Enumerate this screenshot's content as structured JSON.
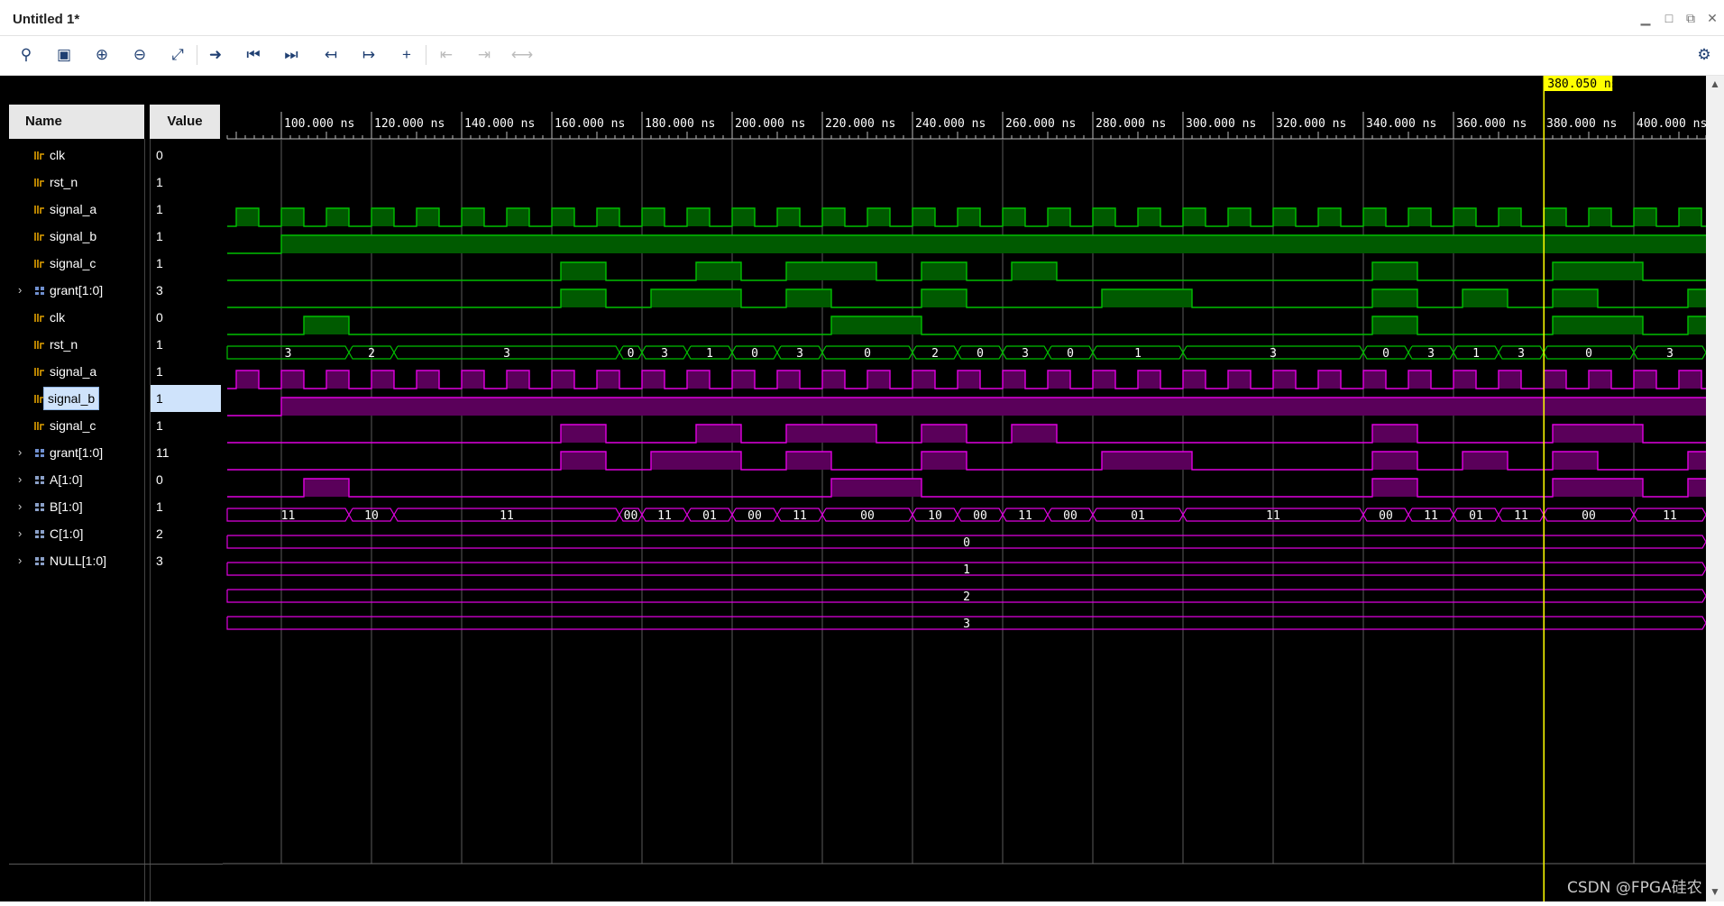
{
  "window": {
    "title": "Untitled 1*"
  },
  "window_controls": [
    "minimize",
    "maximize",
    "restore",
    "close"
  ],
  "toolbar": {
    "buttons": [
      {
        "name": "search",
        "glyph": "⚲",
        "enabled": true
      },
      {
        "name": "save",
        "glyph": "▣",
        "enabled": true
      },
      {
        "name": "zoom-in",
        "glyph": "⊕",
        "enabled": true
      },
      {
        "name": "zoom-out",
        "glyph": "⊖",
        "enabled": true
      },
      {
        "name": "zoom-fit",
        "glyph": "⤢",
        "enabled": true
      },
      {
        "name": "go-to-cursor",
        "glyph": "➜",
        "enabled": true
      },
      {
        "name": "go-to-time-zero",
        "glyph": "⏮",
        "enabled": true
      },
      {
        "name": "go-to-last-time",
        "glyph": "⏭",
        "enabled": true
      },
      {
        "name": "previous-transition",
        "glyph": "↤",
        "enabled": true
      },
      {
        "name": "next-transition",
        "glyph": "↦",
        "enabled": true
      },
      {
        "name": "add-marker",
        "glyph": "+",
        "enabled": true
      },
      {
        "name": "previous-marker",
        "glyph": "⇤",
        "enabled": false
      },
      {
        "name": "next-marker",
        "glyph": "⇥",
        "enabled": false
      },
      {
        "name": "swap-cursors",
        "glyph": "⟷",
        "enabled": false
      }
    ],
    "settings_glyph": "⚙"
  },
  "columns": {
    "name_header": "Name",
    "value_header": "Value"
  },
  "cursor": {
    "label": "380.050",
    "unit": "ns",
    "time": 380.05,
    "color": "#ffff00"
  },
  "timeline": {
    "start": 88,
    "end": 416,
    "ticks": [
      {
        "label": "100.000",
        "unit": "ns",
        "t": 100
      },
      {
        "label": "120.000",
        "unit": "ns",
        "t": 120
      },
      {
        "label": "140.000",
        "unit": "ns",
        "t": 140
      },
      {
        "label": "160.000",
        "unit": "ns",
        "t": 160
      },
      {
        "label": "180.000",
        "unit": "ns",
        "t": 180
      },
      {
        "label": "200.000",
        "unit": "ns",
        "t": 200
      },
      {
        "label": "220.000",
        "unit": "ns",
        "t": 220
      },
      {
        "label": "240.000",
        "unit": "ns",
        "t": 240
      },
      {
        "label": "260.000",
        "unit": "ns",
        "t": 260
      },
      {
        "label": "280.000",
        "unit": "ns",
        "t": 280
      },
      {
        "label": "300.000",
        "unit": "ns",
        "t": 300
      },
      {
        "label": "320.000",
        "unit": "ns",
        "t": 320
      },
      {
        "label": "340.000",
        "unit": "ns",
        "t": 340
      },
      {
        "label": "360.000",
        "unit": "ns",
        "t": 360
      },
      {
        "label": "380.000",
        "unit": "ns",
        "t": 380
      },
      {
        "label": "400.000",
        "unit": "ns",
        "t": 400
      }
    ]
  },
  "colors": {
    "green": "#00c000",
    "green_fill": "#005a00",
    "magenta": "#e000e0",
    "magenta_fill": "#5a005a",
    "grid": "#5a5a5a",
    "cursor": "#ffff00",
    "bus_text": "#ffffff"
  },
  "signals": [
    {
      "name": "clk",
      "value": "0",
      "icon": "bit",
      "expandable": false,
      "color": "green",
      "kind": "clock",
      "period": 10,
      "phase": -3
    },
    {
      "name": "rst_n",
      "value": "1",
      "icon": "bit",
      "expandable": false,
      "color": "green",
      "kind": "bit",
      "edges": [
        [
          88,
          0
        ],
        [
          100,
          1
        ]
      ]
    },
    {
      "name": "signal_a",
      "value": "1",
      "icon": "bit",
      "expandable": false,
      "color": "green",
      "kind": "bit",
      "edges": [
        [
          88,
          0
        ],
        [
          162,
          1
        ],
        [
          172,
          0
        ],
        [
          192,
          1
        ],
        [
          202,
          0
        ],
        [
          212,
          1
        ],
        [
          232,
          0
        ],
        [
          242,
          1
        ],
        [
          252,
          0
        ],
        [
          262,
          1
        ],
        [
          272,
          0
        ],
        [
          342,
          1
        ],
        [
          352,
          0
        ],
        [
          382,
          1
        ],
        [
          402,
          0
        ]
      ]
    },
    {
      "name": "signal_b",
      "value": "1",
      "icon": "bit",
      "expandable": false,
      "color": "green",
      "kind": "bit",
      "edges": [
        [
          88,
          0
        ],
        [
          162,
          1
        ],
        [
          172,
          0
        ],
        [
          182,
          1
        ],
        [
          202,
          0
        ],
        [
          212,
          1
        ],
        [
          222,
          0
        ],
        [
          242,
          1
        ],
        [
          252,
          0
        ],
        [
          282,
          1
        ],
        [
          302,
          0
        ],
        [
          342,
          1
        ],
        [
          352,
          0
        ],
        [
          362,
          1
        ],
        [
          372,
          0
        ],
        [
          382,
          1
        ],
        [
          392,
          0
        ],
        [
          412,
          1
        ]
      ]
    },
    {
      "name": "signal_c",
      "value": "1",
      "icon": "bit",
      "expandable": false,
      "color": "green",
      "kind": "bit",
      "edges": [
        [
          88,
          0
        ],
        [
          105,
          1
        ],
        [
          115,
          0
        ],
        [
          222,
          1
        ],
        [
          242,
          0
        ],
        [
          342,
          1
        ],
        [
          352,
          0
        ],
        [
          382,
          1
        ],
        [
          402,
          0
        ],
        [
          412,
          1
        ]
      ]
    },
    {
      "name": "grant[1:0]",
      "value": "3",
      "icon": "bus",
      "expandable": true,
      "color": "green",
      "kind": "bus",
      "segments": [
        [
          88,
          "3"
        ],
        [
          115,
          "2"
        ],
        [
          125,
          "3"
        ],
        [
          175,
          "0"
        ],
        [
          180,
          "3"
        ],
        [
          190,
          "1"
        ],
        [
          200,
          "0"
        ],
        [
          210,
          "3"
        ],
        [
          220,
          "0"
        ],
        [
          240,
          "2"
        ],
        [
          250,
          "0"
        ],
        [
          260,
          "3"
        ],
        [
          270,
          "0"
        ],
        [
          280,
          "1"
        ],
        [
          300,
          "3"
        ],
        [
          340,
          "0"
        ],
        [
          350,
          "3"
        ],
        [
          360,
          "1"
        ],
        [
          370,
          "3"
        ],
        [
          380,
          "0"
        ],
        [
          400,
          "3"
        ]
      ]
    },
    {
      "name": "clk",
      "value": "0",
      "icon": "bit",
      "expandable": false,
      "color": "magenta",
      "kind": "clock",
      "period": 10,
      "phase": -3
    },
    {
      "name": "rst_n",
      "value": "1",
      "icon": "bit",
      "expandable": false,
      "color": "magenta",
      "kind": "bit",
      "edges": [
        [
          88,
          0
        ],
        [
          100,
          1
        ]
      ]
    },
    {
      "name": "signal_a",
      "value": "1",
      "icon": "bit",
      "expandable": false,
      "color": "magenta",
      "kind": "bit",
      "edges": [
        [
          88,
          0
        ],
        [
          162,
          1
        ],
        [
          172,
          0
        ],
        [
          192,
          1
        ],
        [
          202,
          0
        ],
        [
          212,
          1
        ],
        [
          232,
          0
        ],
        [
          242,
          1
        ],
        [
          252,
          0
        ],
        [
          262,
          1
        ],
        [
          272,
          0
        ],
        [
          342,
          1
        ],
        [
          352,
          0
        ],
        [
          382,
          1
        ],
        [
          402,
          0
        ]
      ]
    },
    {
      "name": "signal_b",
      "value": "1",
      "icon": "bit",
      "expandable": false,
      "color": "magenta",
      "kind": "bit",
      "selected": true,
      "edges": [
        [
          88,
          0
        ],
        [
          162,
          1
        ],
        [
          172,
          0
        ],
        [
          182,
          1
        ],
        [
          202,
          0
        ],
        [
          212,
          1
        ],
        [
          222,
          0
        ],
        [
          242,
          1
        ],
        [
          252,
          0
        ],
        [
          282,
          1
        ],
        [
          302,
          0
        ],
        [
          342,
          1
        ],
        [
          352,
          0
        ],
        [
          362,
          1
        ],
        [
          372,
          0
        ],
        [
          382,
          1
        ],
        [
          392,
          0
        ],
        [
          412,
          1
        ]
      ]
    },
    {
      "name": "signal_c",
      "value": "1",
      "icon": "bit",
      "expandable": false,
      "color": "magenta",
      "kind": "bit",
      "edges": [
        [
          88,
          0
        ],
        [
          105,
          1
        ],
        [
          115,
          0
        ],
        [
          222,
          1
        ],
        [
          242,
          0
        ],
        [
          342,
          1
        ],
        [
          352,
          0
        ],
        [
          382,
          1
        ],
        [
          402,
          0
        ],
        [
          412,
          1
        ]
      ]
    },
    {
      "name": "grant[1:0]",
      "value": "11",
      "icon": "bus",
      "expandable": true,
      "color": "magenta",
      "kind": "bus",
      "segments": [
        [
          88,
          "11"
        ],
        [
          115,
          "10"
        ],
        [
          125,
          "11"
        ],
        [
          175,
          "00"
        ],
        [
          180,
          "11"
        ],
        [
          190,
          "01"
        ],
        [
          200,
          "00"
        ],
        [
          210,
          "11"
        ],
        [
          220,
          "00"
        ],
        [
          240,
          "10"
        ],
        [
          250,
          "00"
        ],
        [
          260,
          "11"
        ],
        [
          270,
          "00"
        ],
        [
          280,
          "01"
        ],
        [
          300,
          "11"
        ],
        [
          340,
          "00"
        ],
        [
          350,
          "11"
        ],
        [
          360,
          "01"
        ],
        [
          370,
          "11"
        ],
        [
          380,
          "00"
        ],
        [
          400,
          "11"
        ]
      ]
    },
    {
      "name": "A[1:0]",
      "value": "0",
      "icon": "param",
      "expandable": true,
      "color": "magenta",
      "kind": "bus",
      "segments": [
        [
          88,
          "0"
        ]
      ]
    },
    {
      "name": "B[1:0]",
      "value": "1",
      "icon": "param",
      "expandable": true,
      "color": "magenta",
      "kind": "bus",
      "segments": [
        [
          88,
          "1"
        ]
      ]
    },
    {
      "name": "C[1:0]",
      "value": "2",
      "icon": "param",
      "expandable": true,
      "color": "magenta",
      "kind": "bus",
      "segments": [
        [
          88,
          "2"
        ]
      ]
    },
    {
      "name": "NULL[1:0]",
      "value": "3",
      "icon": "param",
      "expandable": true,
      "color": "magenta",
      "kind": "bus",
      "segments": [
        [
          88,
          "3"
        ]
      ]
    }
  ],
  "watermark": "CSDN @FPGA硅农"
}
